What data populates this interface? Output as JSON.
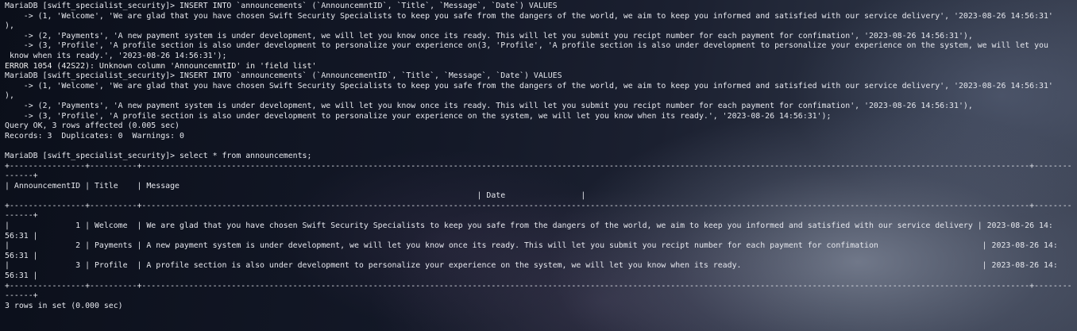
{
  "terminal": {
    "lines": [
      "MariaDB [swift_specialist_security]> INSERT INTO `announcements` (`AnnouncemntID`, `Title`, `Message`, `Date`) VALUES",
      "    -> (1, 'Welcome', 'We are glad that you have chosen Swift Security Specialists to keep you safe from the dangers of the world, we aim to keep you informed and satisfied with our service delivery', '2023-08-26 14:56:31'",
      "),",
      "    -> (2, 'Payments', 'A new payment system is under development, we will let you know once its ready. This will let you submit you recipt number for each payment for confimation', '2023-08-26 14:56:31'),",
      "    -> (3, 'Profile', 'A profile section is also under development to personalize your experience on(3, 'Profile', 'A profile section is also under development to personalize your experience on the system, we will let you",
      " know when its ready.', '2023-08-26 14:56:31');",
      "ERROR 1054 (42S22): Unknown column 'AnnouncemntID' in 'field list'",
      "MariaDB [swift_specialist_security]> INSERT INTO `announcements` (`AnnouncementID`, `Title`, `Message`, `Date`) VALUES",
      "    -> (1, 'Welcome', 'We are glad that you have chosen Swift Security Specialists to keep you safe from the dangers of the world, we aim to keep you informed and satisfied with our service delivery', '2023-08-26 14:56:31'",
      "),",
      "    -> (2, 'Payments', 'A new payment system is under development, we will let you know once its ready. This will let you submit you recipt number for each payment for confimation', '2023-08-26 14:56:31'),",
      "    -> (3, 'Profile', 'A profile section is also under development to personalize your experience on the system, we will let you know when its ready.', '2023-08-26 14:56:31');",
      "Query OK, 3 rows affected (0.005 sec)",
      "Records: 3  Duplicates: 0  Warnings: 0",
      "",
      "MariaDB [swift_specialist_security]> select * from announcements;",
      "+----------------+----------+--------------------------------------------------------------------------------------------------------------------------------------------------------------------------------------------+---------------",
      "------+",
      "| AnnouncementID | Title    | Message",
      "                                                                                                    | Date                |",
      "+----------------+----------+--------------------------------------------------------------------------------------------------------------------------------------------------------------------------------------------+---------------",
      "------+",
      "|              1 | Welcome  | We are glad that you have chosen Swift Security Specialists to keep you safe from the dangers of the world, we aim to keep you informed and satisfied with our service delivery | 2023-08-26 14:",
      "56:31 |",
      "|              2 | Payments | A new payment system is under development, we will let you know once its ready. This will let you submit you recipt number for each payment for confimation                      | 2023-08-26 14:",
      "56:31 |",
      "|              3 | Profile  | A profile section is also under development to personalize your experience on the system, we will let you know when its ready.                                                   | 2023-08-26 14:",
      "56:31 |",
      "+----------------+----------+--------------------------------------------------------------------------------------------------------------------------------------------------------------------------------------------+---------------",
      "------+",
      "3 rows in set (0.000 sec)"
    ]
  }
}
